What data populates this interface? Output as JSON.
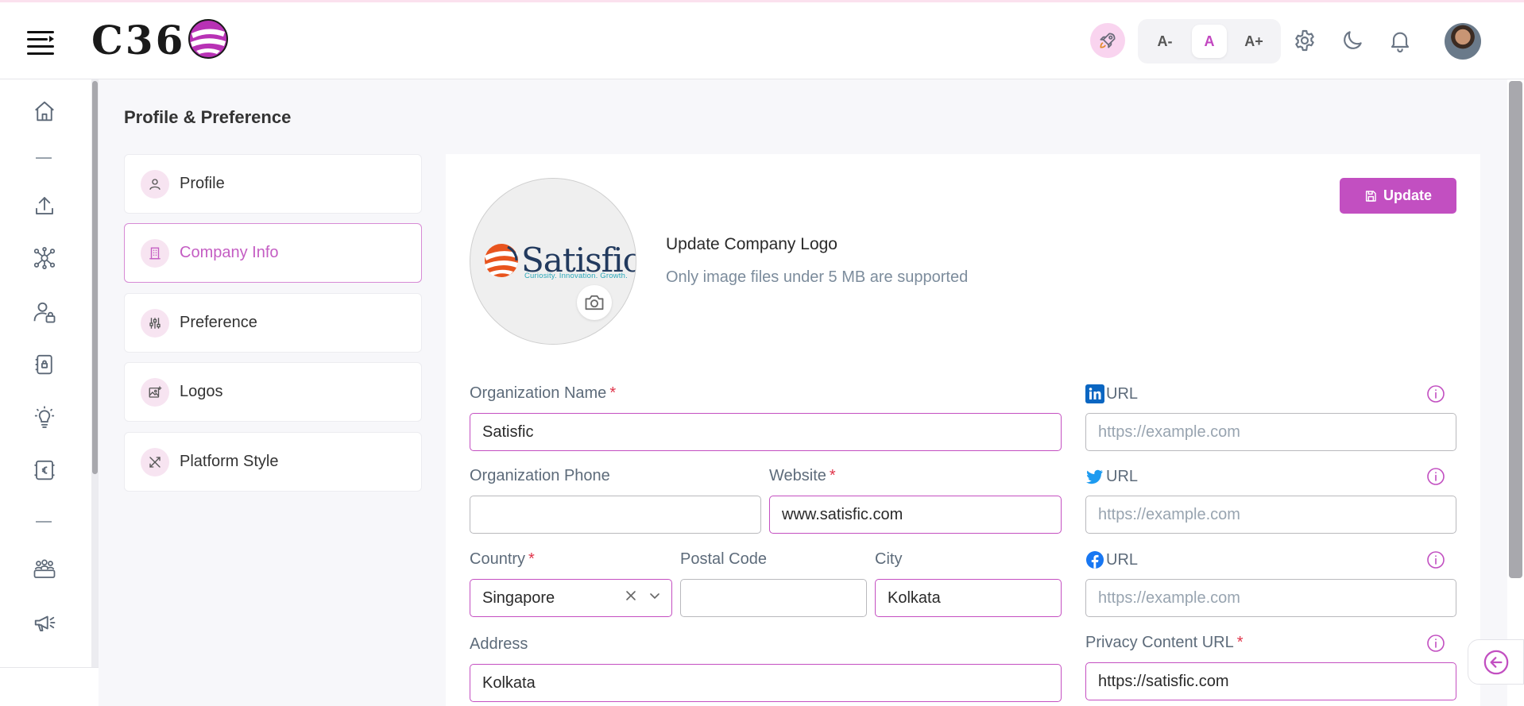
{
  "brand": {
    "name": "C36"
  },
  "header": {
    "font_sizes": [
      {
        "label": "A-",
        "active": false
      },
      {
        "label": "A",
        "active": true
      },
      {
        "label": "A+",
        "active": false
      }
    ],
    "icons": [
      "rocket-icon",
      "gear-icon",
      "moon-icon",
      "bell-icon",
      "user-avatar"
    ]
  },
  "sidenav": {
    "icons": [
      "home-icon",
      "upload-icon",
      "network-icon",
      "user-lock-icon",
      "document-lock-icon",
      "lightbulb-icon",
      "currency-card-icon",
      "team-icon",
      "megaphone-icon"
    ]
  },
  "page": {
    "title": "Profile & Preference"
  },
  "menu": [
    {
      "label": "Profile",
      "icon": "user-icon",
      "active": false
    },
    {
      "label": "Company Info",
      "icon": "building-icon",
      "active": true
    },
    {
      "label": "Preference",
      "icon": "sliders-icon",
      "active": false
    },
    {
      "label": "Logos",
      "icon": "image-icon",
      "active": false
    },
    {
      "label": "Platform Style",
      "icon": "tools-icon",
      "active": false
    }
  ],
  "logo": {
    "company_word": "Satisfic",
    "tagline": "Curiosity. Innovation. Growth.",
    "heading": "Update Company Logo",
    "hint": "Only image files under 5 MB are supported"
  },
  "actions": {
    "update_label": "Update"
  },
  "form": {
    "org_name": {
      "label": "Organization Name",
      "required": "*",
      "value": "Satisfic"
    },
    "org_phone": {
      "label": "Organization Phone",
      "value": ""
    },
    "website": {
      "label": "Website",
      "required": "*",
      "value": "www.satisfic.com"
    },
    "country": {
      "label": "Country",
      "required": "*",
      "value": "Singapore"
    },
    "postal_code": {
      "label": "Postal Code",
      "value": ""
    },
    "city": {
      "label": "City",
      "value": "Kolkata"
    },
    "address": {
      "label": "Address",
      "value": "Kolkata"
    },
    "linkedin": {
      "label": "URL",
      "placeholder": "https://example.com"
    },
    "twitter": {
      "label": "URL",
      "placeholder": "https://example.com"
    },
    "facebook": {
      "label": "URL",
      "placeholder": "https://example.com"
    },
    "privacy_url": {
      "label": "Privacy Content URL",
      "required": "*",
      "value": "https://satisfic.com"
    }
  },
  "colors": {
    "accent": "#c24fc1",
    "accent_light": "#f7e4f1",
    "linkedin": "#0a66c2",
    "twitter": "#1d9bf0",
    "facebook": "#1877f2"
  }
}
